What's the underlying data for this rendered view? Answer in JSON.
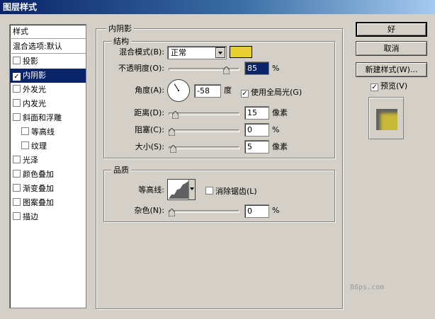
{
  "window": {
    "title": "图层样式"
  },
  "left_panel": {
    "header": "样式",
    "blend_options": "混合选项:默认",
    "items": [
      {
        "label": "投影",
        "checked": false
      },
      {
        "label": "内阴影",
        "checked": true,
        "selected": true
      },
      {
        "label": "外发光",
        "checked": false
      },
      {
        "label": "内发光",
        "checked": false
      },
      {
        "label": "斜面和浮雕",
        "checked": false
      },
      {
        "label": "等高线",
        "checked": false,
        "indent": true
      },
      {
        "label": "纹理",
        "checked": false,
        "indent": true
      },
      {
        "label": "光泽",
        "checked": false
      },
      {
        "label": "颜色叠加",
        "checked": false
      },
      {
        "label": "渐变叠加",
        "checked": false
      },
      {
        "label": "图案叠加",
        "checked": false
      },
      {
        "label": "描边",
        "checked": false
      }
    ]
  },
  "inner_shadow": {
    "title": "内阴影",
    "structure": {
      "title": "结构",
      "blend_mode_label": "混合模式(B):",
      "blend_mode_value": "正常",
      "color": "#e8d030",
      "opacity_label": "不透明度(O):",
      "opacity_value": "85",
      "opacity_fraction": 0.85,
      "opacity_unit": "%",
      "angle_label": "角度(A):",
      "angle_value": "-58",
      "angle_unit": "度",
      "global_light_label": "使用全局光(G)",
      "global_light_checked": true,
      "distance_label": "距离(D):",
      "distance_value": "15",
      "distance_unit": "像素",
      "distance_fraction": 0.06,
      "choke_label": "阻塞(C):",
      "choke_value": "0",
      "choke_unit": "%",
      "choke_fraction": 0,
      "size_label": "大小(S):",
      "size_value": "5",
      "size_unit": "像素",
      "size_fraction": 0.02
    },
    "quality": {
      "title": "品质",
      "contour_label": "等高线:",
      "anti_alias_label": "消除锯齿(L)",
      "anti_alias_checked": false,
      "noise_label": "杂色(N):",
      "noise_value": "0",
      "noise_unit": "%",
      "noise_fraction": 0
    }
  },
  "buttons": {
    "ok": "好",
    "cancel": "取消",
    "new_style": "新建样式(W)...",
    "preview_label": "预览(V)",
    "preview_checked": true
  },
  "watermark": "86ps.com"
}
